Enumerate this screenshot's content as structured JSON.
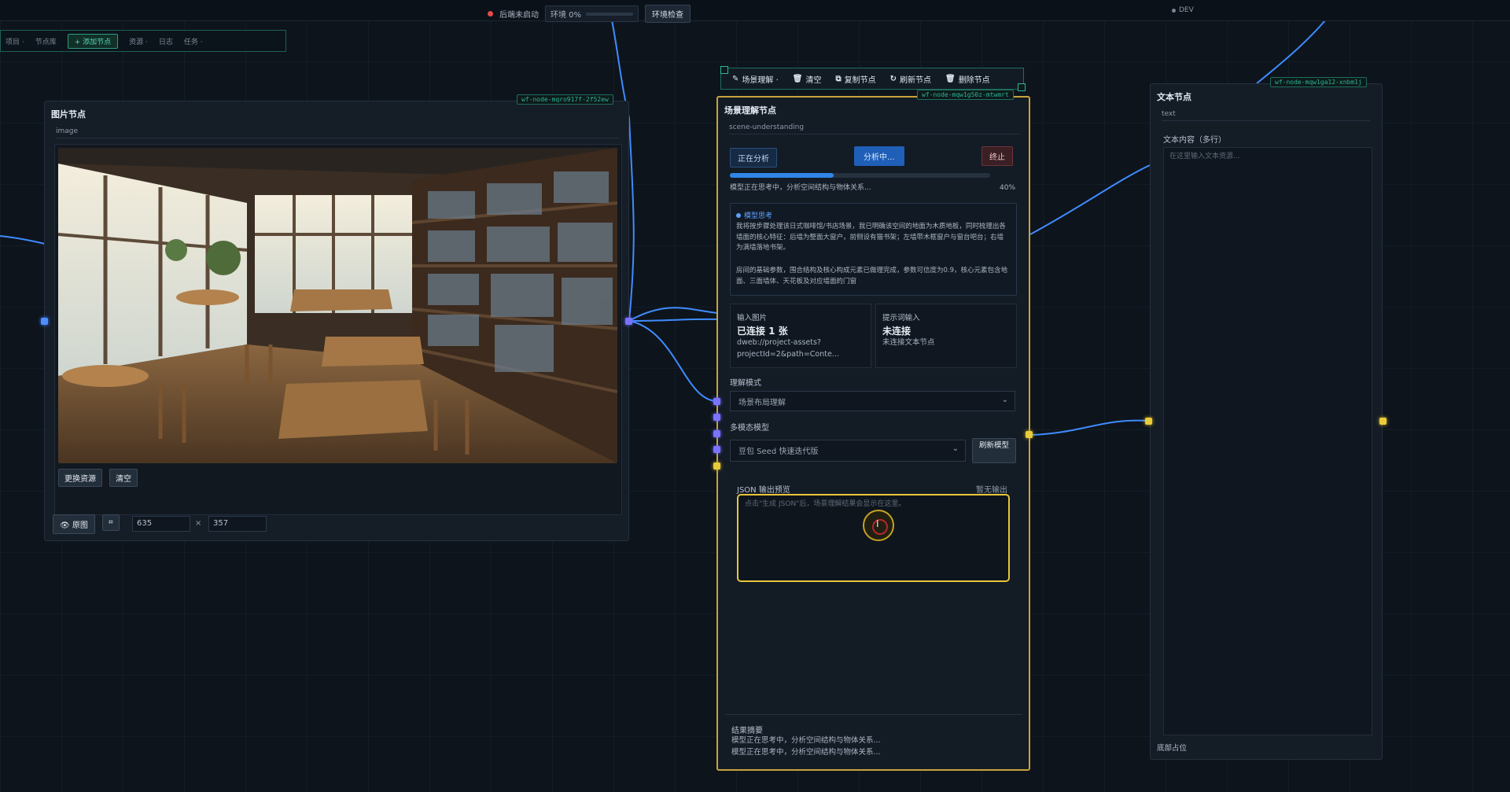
{
  "topbar": {
    "status_text": "后端未启动",
    "env_progress": "环境 0%",
    "env_check_button": "环境检查",
    "mode": "DEV"
  },
  "toolbar": {
    "items": [
      "项目 ·",
      "节点库",
      "+ 添加节点",
      "资源 ·",
      "日志",
      "任务 ·"
    ]
  },
  "image_node": {
    "title": "图片节点",
    "subtitle": "image",
    "id_tag": "wf-node-mqro917f-2f52ew",
    "replace_button": "更换资源",
    "clear_button": "清空",
    "original_button": "原图",
    "width": "635",
    "height": "357",
    "times": "×"
  },
  "scene_toolbar": {
    "items": [
      "场景理解 ·",
      "清空",
      "复制节点",
      "刷新节点",
      "删除节点"
    ]
  },
  "scene_node": {
    "title": "场景理解节点",
    "subtitle": "scene-understanding",
    "id_tag": "wf-node-mqw1g50z-mtwmrt",
    "analyzing_chip": "正在分析",
    "analyzing_button": "分析中...",
    "stop_button": "终止",
    "progress_text": "模型正在思考中，分析空间结构与物体关系...",
    "progress_percent": "40%",
    "progress_value": 0.4,
    "thinking_title": "模型思考",
    "thinking_p1": "我将按步骤处理该日式咖啡馆/书店场景，我已明确该空间的地面为木质地板，同时梳理出各墙面的核心特征：后墙为整面大窗户，前侧设有猫书架；左墙带木框窗户与窗台吧台；右墙为满墙落地书架。",
    "thinking_p2": "房间的基础参数，围合结构及核心构成元素已做理完成，参数可信度为0.9，核心元素包含地面、三面墙体、天花板及对应墙面的门窗",
    "input_image_label": "输入图片",
    "input_image_status": "已连接 1 张",
    "input_image_path": "dweb://project-assets?projectId=2&path=Conte...",
    "prompt_input_label": "提示词输入",
    "prompt_input_status": "未连接",
    "prompt_input_desc": "未连接文本节点",
    "mode_label": "理解模式",
    "mode_value": "场景布局理解",
    "model_label": "多模态模型",
    "model_value": "豆包 Seed 快速迭代版",
    "refresh_model_button": "刷新模型",
    "json_label": "JSON 输出预览",
    "json_status": "暂无输出",
    "json_placeholder": "点击\"生成 JSON\"后，场景理解结果会显示在这里。",
    "summary_label": "结果摘要",
    "summary_line1": "模型正在思考中，分析空间结构与物体关系...",
    "summary_line2": "模型正在思考中，分析空间结构与物体关系..."
  },
  "text_node": {
    "title": "文本节点",
    "subtitle": "text",
    "id_tag": "wf-node-mqw1ga12-xnbm1j",
    "content_label": "文本内容（多行）",
    "placeholder": "在这里输入文本资源...",
    "footer": "底部占位"
  },
  "colors": {
    "accent_teal": "#2cb59a",
    "wire_blue": "#3f8cff",
    "highlight_yellow": "#e8c63a",
    "progress_blue": "#2f86e8"
  }
}
